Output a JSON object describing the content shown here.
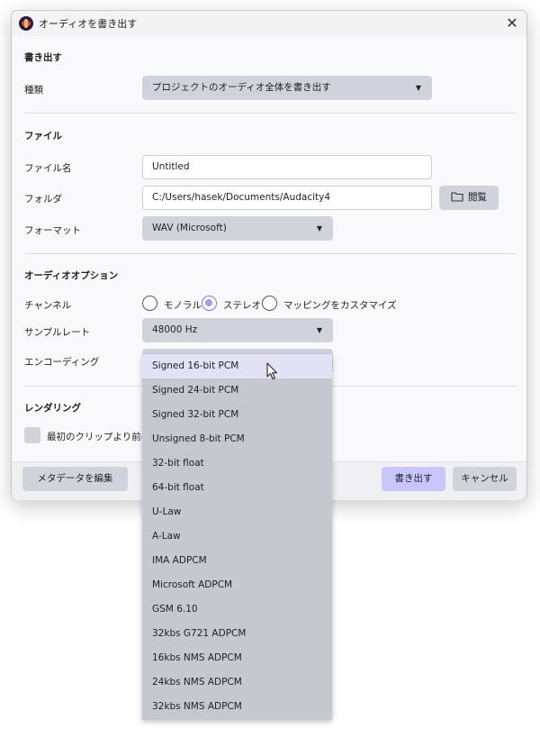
{
  "window": {
    "title": "オーディオを書き出す",
    "close_symbol": "✕"
  },
  "export": {
    "header": "書き出す",
    "type_label": "種類",
    "type_value": "プロジェクトのオーディオ全体を書き出す"
  },
  "file": {
    "header": "ファイル",
    "name_label": "ファイル名",
    "name_value": "Untitled",
    "folder_label": "フォルダ",
    "folder_value": "C:/Users/hasek/Documents/Audacity4",
    "browse_label": "閲覧",
    "format_label": "フォーマット",
    "format_value": "WAV (Microsoft)"
  },
  "audio": {
    "header": "オーディオオプション",
    "channels_label": "チャンネル",
    "mono_label": "モノラル",
    "stereo_label": "ステレオ",
    "custom_label": "マッピングをカスタマイズ",
    "selected_channel": "stereo",
    "sample_rate_label": "サンプルレート",
    "sample_rate_value": "48000 Hz",
    "encoding_label": "エンコーディング"
  },
  "rendering": {
    "header": "レンダリング",
    "checkbox_label": "最初のクリップより前の空"
  },
  "footer": {
    "metadata_label": "メタデータを編集",
    "export_label": "書き出す",
    "cancel_label": "キャンセル"
  },
  "encoding_options": [
    "Signed 16-bit PCM",
    "Signed 24-bit PCM",
    "Signed 32-bit PCM",
    "Unsigned 8-bit PCM",
    "32-bit float",
    "64-bit float",
    "U-Law",
    "A-Law",
    "IMA ADPCM",
    "Microsoft ADPCM",
    "GSM 6.10",
    "32kbs G721 ADPCM",
    "16kbs NMS ADPCM",
    "24kbs NMS ADPCM",
    "32kbs NMS ADPCM"
  ],
  "highlighted_option": "Signed 16-bit PCM",
  "colors": {
    "accent": "#c9c6ff",
    "control": "#d2d2dc",
    "dropdown_bg": "#c7c7d0",
    "highlight": "#e3e1f6"
  }
}
